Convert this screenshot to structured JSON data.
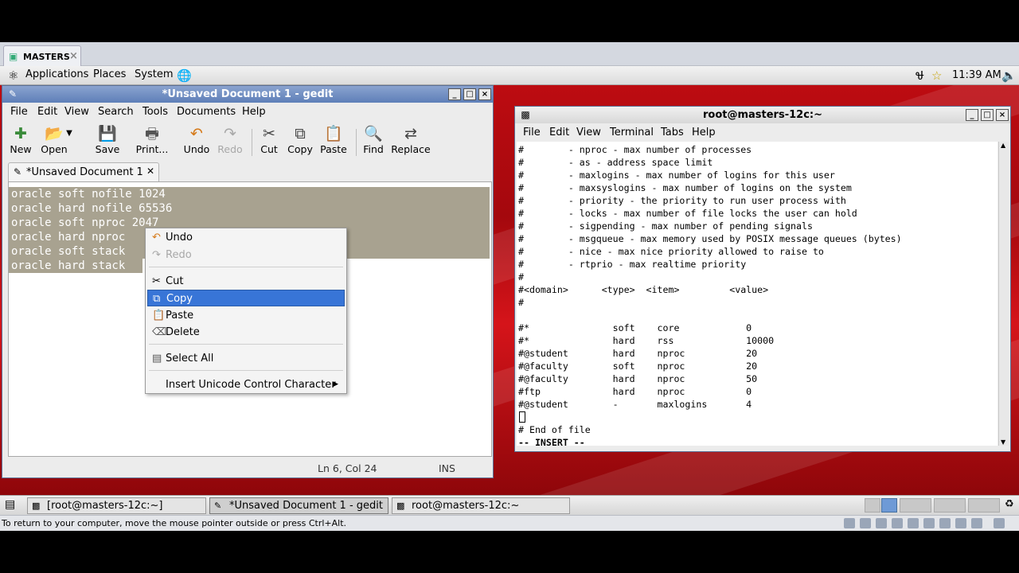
{
  "vm": {
    "tab_label": "MASTERS",
    "status_message": "To return to your computer, move the mouse pointer outside or press Ctrl+Alt."
  },
  "panel": {
    "menus": [
      "Applications",
      "Places",
      "System"
    ],
    "clock": "11:39 AM"
  },
  "gedit": {
    "title": "*Unsaved Document 1 - gedit",
    "menus": [
      "File",
      "Edit",
      "View",
      "Search",
      "Tools",
      "Documents",
      "Help"
    ],
    "toolbar": {
      "new": "New",
      "open": "Open",
      "save": "Save",
      "print": "Print...",
      "undo": "Undo",
      "redo": "Redo",
      "cut": "Cut",
      "copy": "Copy",
      "paste": "Paste",
      "find": "Find",
      "replace": "Replace"
    },
    "tab_label": "*Unsaved Document 1",
    "lines": [
      "oracle soft nofile 1024",
      "oracle hard nofile 65536",
      "oracle soft nproc 2047",
      "oracle hard nproc",
      "oracle soft stack",
      "oracle hard stack"
    ],
    "status": {
      "position": "Ln 6, Col 24",
      "mode": "INS"
    }
  },
  "context_menu": {
    "undo": "Undo",
    "redo": "Redo",
    "cut": "Cut",
    "copy": "Copy",
    "paste": "Paste",
    "delete": "Delete",
    "select_all": "Select All",
    "unicode": "Insert Unicode Control Character"
  },
  "terminal": {
    "title": "root@masters-12c:~",
    "menus": [
      "File",
      "Edit",
      "View",
      "Terminal",
      "Tabs",
      "Help"
    ],
    "lines": [
      "#        - nproc - max number of processes",
      "#        - as - address space limit",
      "#        - maxlogins - max number of logins for this user",
      "#        - maxsyslogins - max number of logins on the system",
      "#        - priority - the priority to run user process with",
      "#        - locks - max number of file locks the user can hold",
      "#        - sigpending - max number of pending signals",
      "#        - msgqueue - max memory used by POSIX message queues (bytes)",
      "#        - nice - max nice priority allowed to raise to",
      "#        - rtprio - max realtime priority",
      "#",
      "#<domain>      <type>  <item>         <value>",
      "#",
      "",
      "#*               soft    core            0",
      "#*               hard    rss             10000",
      "#@student        hard    nproc           20",
      "#@faculty        soft    nproc           20",
      "#@faculty        hard    nproc           50",
      "#ftp             hard    nproc           0",
      "#@student        -       maxlogins       4",
      "",
      "# End of file"
    ],
    "mode_line": "-- INSERT --"
  },
  "taskbar": {
    "tasks": [
      "[root@masters-12c:~]",
      "*Unsaved Document 1 - gedit",
      "root@masters-12c:~"
    ]
  }
}
